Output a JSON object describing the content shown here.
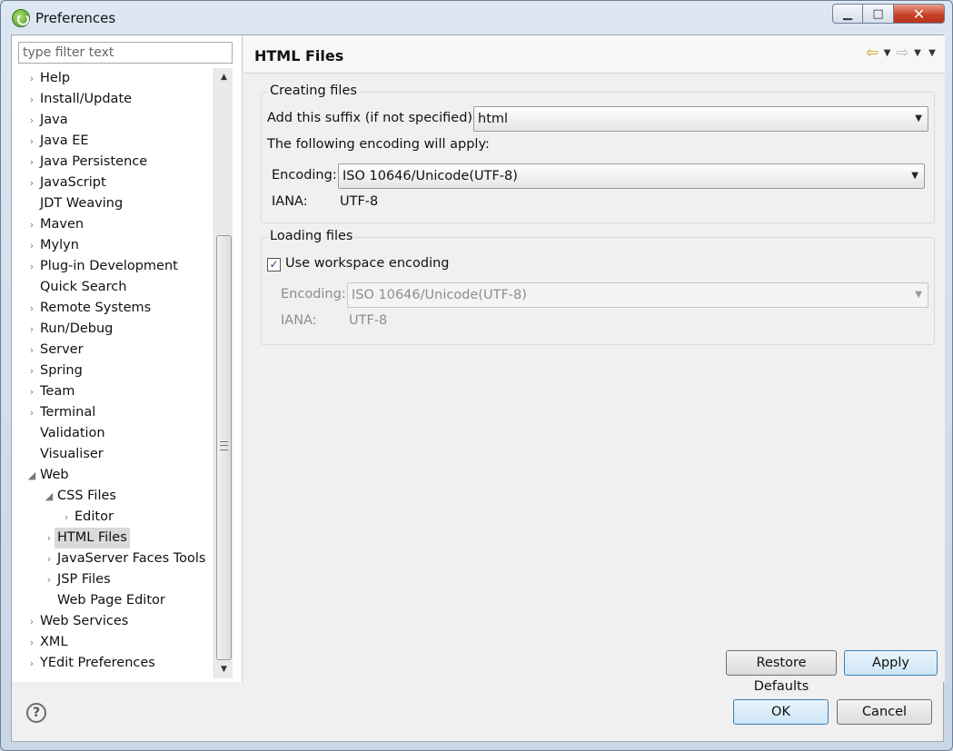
{
  "window": {
    "title": "Preferences",
    "minimize_label": "▁",
    "maximize_label": "□",
    "close_label": "✕"
  },
  "filter": {
    "placeholder": "type filter text",
    "value": ""
  },
  "tree": {
    "items": [
      {
        "label": "Help",
        "expand": "›",
        "selected": false
      },
      {
        "label": "Install/Update",
        "expand": "›",
        "selected": false
      },
      {
        "label": "Java",
        "expand": "›",
        "selected": false
      },
      {
        "label": "Java EE",
        "expand": "›",
        "selected": false
      },
      {
        "label": "Java Persistence",
        "expand": "›",
        "selected": false
      },
      {
        "label": "JavaScript",
        "expand": "›",
        "selected": false
      },
      {
        "label": "JDT Weaving",
        "expand": "",
        "selected": false
      },
      {
        "label": "Maven",
        "expand": "›",
        "selected": false
      },
      {
        "label": "Mylyn",
        "expand": "›",
        "selected": false
      },
      {
        "label": "Plug-in Development",
        "expand": "›",
        "selected": false
      },
      {
        "label": "Quick Search",
        "expand": "",
        "selected": false
      },
      {
        "label": "Remote Systems",
        "expand": "›",
        "selected": false
      },
      {
        "label": "Run/Debug",
        "expand": "›",
        "selected": false
      },
      {
        "label": "Server",
        "expand": "›",
        "selected": false
      },
      {
        "label": "Spring",
        "expand": "›",
        "selected": false
      },
      {
        "label": "Team",
        "expand": "›",
        "selected": false
      },
      {
        "label": "Terminal",
        "expand": "›",
        "selected": false
      },
      {
        "label": "Validation",
        "expand": "",
        "selected": false
      },
      {
        "label": "Visualiser",
        "expand": "",
        "selected": false
      },
      {
        "label": "Web",
        "expand": "◢",
        "selected": false
      },
      {
        "label": "CSS Files",
        "expand": "◢",
        "selected": false
      },
      {
        "label": "Editor",
        "expand": "›",
        "selected": false
      },
      {
        "label": "HTML Files",
        "expand": "›",
        "selected": true
      },
      {
        "label": "JavaServer Faces Tools",
        "expand": "›",
        "selected": false
      },
      {
        "label": "JSP Files",
        "expand": "›",
        "selected": false
      },
      {
        "label": "Web Page Editor",
        "expand": "",
        "selected": false
      },
      {
        "label": "Web Services",
        "expand": "›",
        "selected": false
      },
      {
        "label": "XML",
        "expand": "›",
        "selected": false
      },
      {
        "label": "YEdit Preferences",
        "expand": "›",
        "selected": false
      }
    ]
  },
  "scrollbar": {
    "up": "▲",
    "down": "▼",
    "position": 0.4
  },
  "page": {
    "title": "HTML Files",
    "nav": {
      "back": "⇦",
      "forward": "⇨",
      "dropdown": "▼",
      "menu": "▼"
    },
    "creating": {
      "title": "Creating files",
      "suffix_label": "Add this suffix (if not specified):",
      "suffix_value": "html",
      "encoding_note": "The following encoding will apply:",
      "encoding_label": "Encoding:",
      "encoding_value": "ISO 10646/Unicode(UTF-8)",
      "iana_label": "IANA:",
      "iana_value": "UTF-8"
    },
    "loading": {
      "title": "Loading files",
      "checkbox_label": "Use workspace encoding",
      "checkbox_checked": true,
      "check_mark": "✓",
      "encoding_label": "Encoding:",
      "encoding_value": "ISO 10646/Unicode(UTF-8)",
      "iana_label": "IANA:",
      "iana_value": "UTF-8"
    },
    "restore_defaults": "Restore Defaults",
    "apply": "Apply"
  },
  "footer": {
    "help": "?",
    "ok": "OK",
    "cancel": "Cancel"
  },
  "combo_arrow": "▼"
}
